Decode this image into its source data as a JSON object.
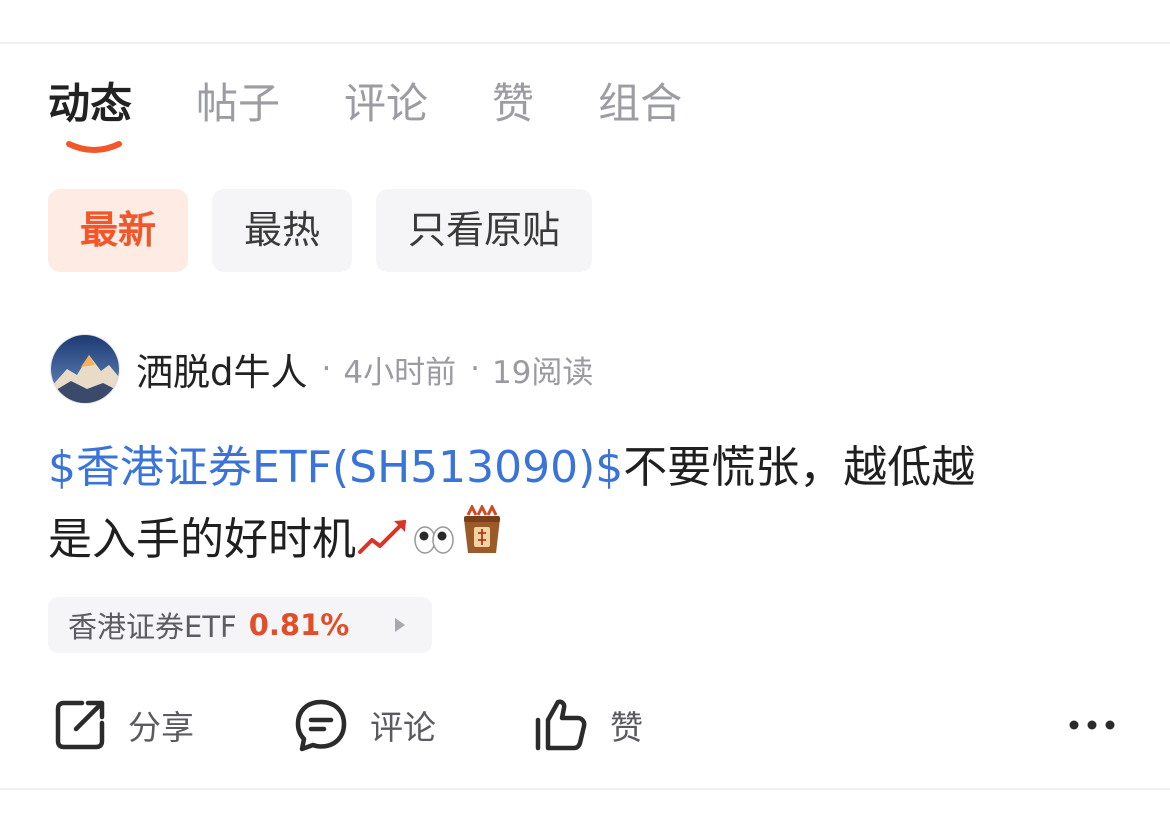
{
  "tabs": [
    {
      "label": "动态"
    },
    {
      "label": "帖子"
    },
    {
      "label": "评论"
    },
    {
      "label": "赞"
    },
    {
      "label": "组合"
    }
  ],
  "filters": [
    {
      "label": "最新"
    },
    {
      "label": "最热"
    },
    {
      "label": "只看原贴"
    }
  ],
  "post": {
    "author": "洒脱d牛人",
    "time": "4小时前",
    "reads": "19阅读",
    "stock_link": "$香港证券ETF(SH513090)$",
    "text_line1": "不要慌张，越低越",
    "text_line2": "是入手的好时机",
    "emojis": [
      "chart-increasing-icon",
      "eyes-icon",
      "fortune-stick-icon"
    ]
  },
  "stock_chip": {
    "name": "香港证券ETF",
    "change": "0.81%"
  },
  "actions": {
    "share": "分享",
    "comment": "评论",
    "like": "赞"
  },
  "colors": {
    "accent": "#f0572a",
    "link": "#3b74d8",
    "up": "#e04f2a"
  }
}
